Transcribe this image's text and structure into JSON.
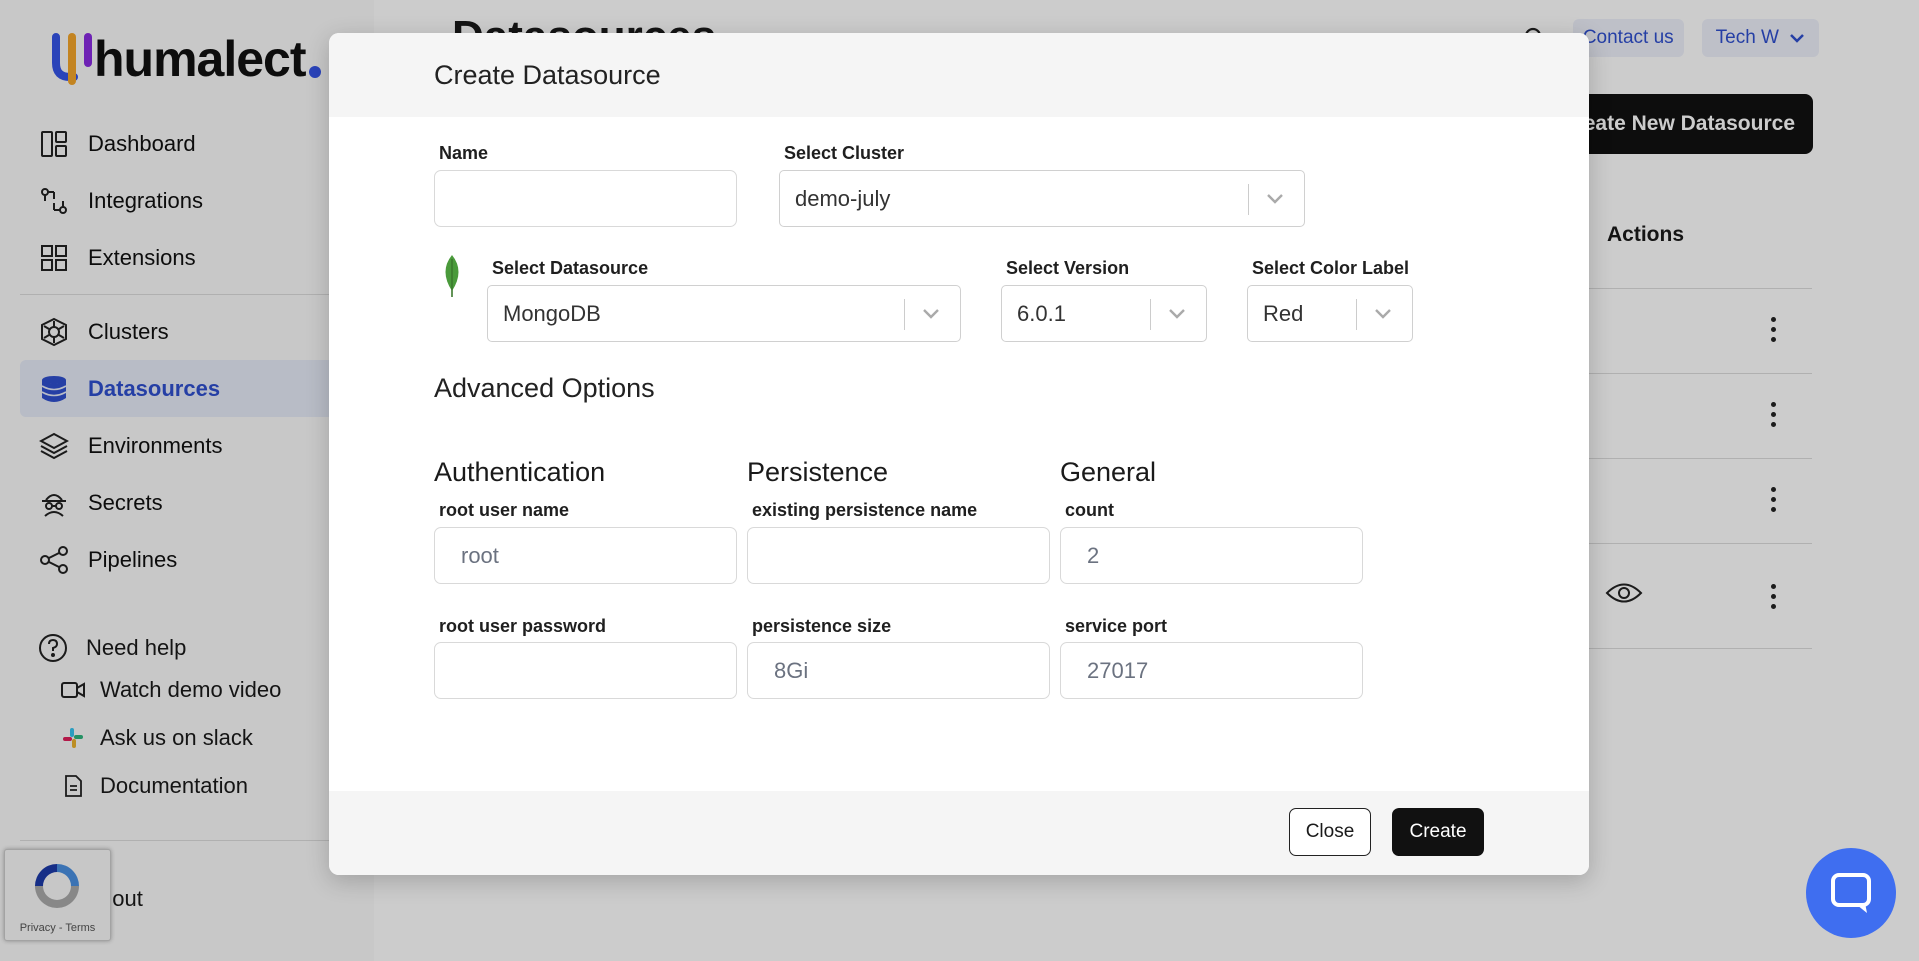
{
  "brand": {
    "name": "humalect"
  },
  "sidebar": {
    "items": [
      {
        "label": "Dashboard",
        "icon": "dashboard-icon"
      },
      {
        "label": "Integrations",
        "icon": "integrations-icon"
      },
      {
        "label": "Extensions",
        "icon": "extensions-icon"
      },
      {
        "label": "Clusters",
        "icon": "clusters-icon"
      },
      {
        "label": "Datasources",
        "icon": "database-icon",
        "active": true
      },
      {
        "label": "Environments",
        "icon": "layers-icon"
      },
      {
        "label": "Secrets",
        "icon": "secrets-icon"
      },
      {
        "label": "Pipelines",
        "icon": "share-icon"
      }
    ],
    "help": {
      "title": "Need help",
      "links": [
        "Watch demo video",
        "Ask us on slack",
        "Documentation"
      ]
    },
    "logout": "gout"
  },
  "recaptcha": {
    "text": "Privacy - Terms"
  },
  "header": {
    "title": "Datasources",
    "contact": "Contact us",
    "user": "Tech W",
    "create_new": "eate New Datasource"
  },
  "table": {
    "actions_header": "Actions"
  },
  "modal": {
    "title": "Create Datasource",
    "name": {
      "label": "Name",
      "value": ""
    },
    "cluster": {
      "label": "Select Cluster",
      "value": "demo-july"
    },
    "datasource": {
      "label": "Select Datasource",
      "value": "MongoDB"
    },
    "version": {
      "label": "Select Version",
      "value": "6.0.1"
    },
    "color_label": {
      "label": "Select Color Label",
      "value": "Red"
    },
    "advanced": "Advanced Options",
    "authentication": {
      "title": "Authentication",
      "root_user_name": {
        "label": "root user name",
        "placeholder": "root"
      },
      "root_user_password": {
        "label": "root user password",
        "placeholder": ""
      }
    },
    "persistence": {
      "title": "Persistence",
      "existing_name": {
        "label": "existing persistence name",
        "placeholder": ""
      },
      "size": {
        "label": "persistence size",
        "placeholder": "8Gi"
      }
    },
    "general": {
      "title": "General",
      "count": {
        "label": "count",
        "placeholder": "2"
      },
      "service_port": {
        "label": "service port",
        "placeholder": "27017"
      }
    },
    "close": "Close",
    "create": "Create"
  },
  "colors": {
    "accent": "#2f4fcf",
    "primary_button": "#111111",
    "chat": "#3f6ef0",
    "mongodb_leaf": "#4a9a3b"
  }
}
